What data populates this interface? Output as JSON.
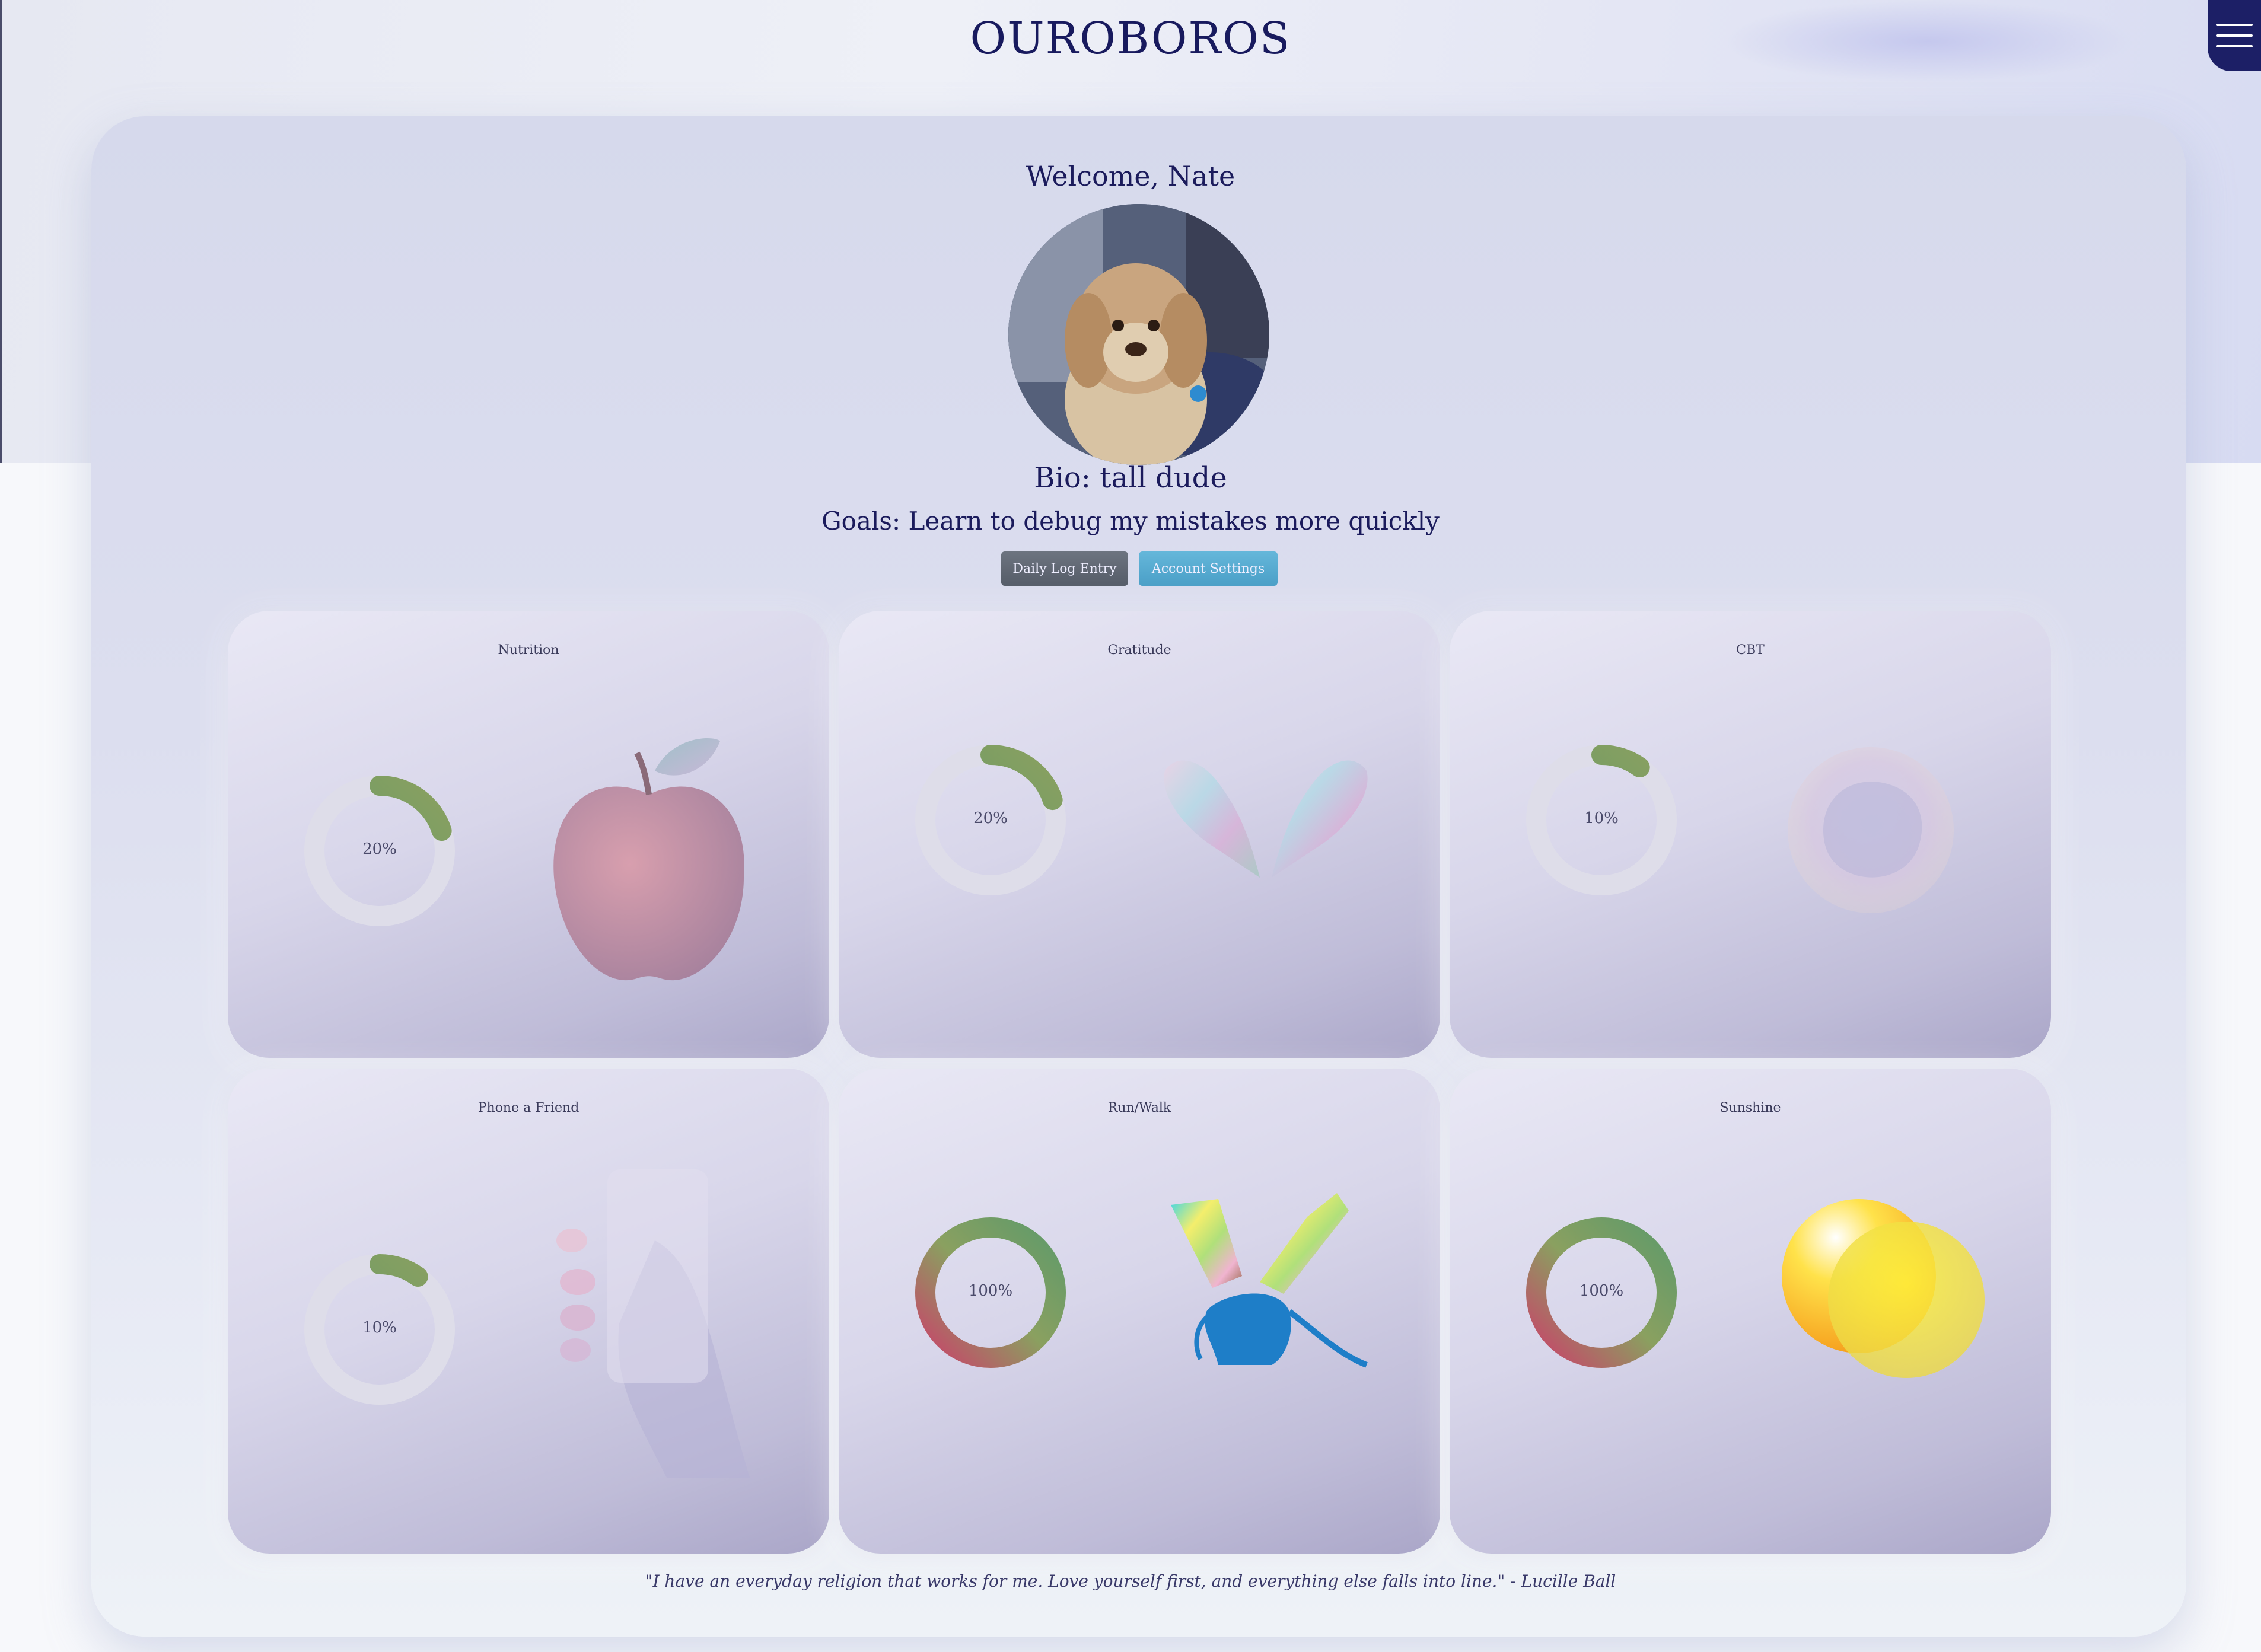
{
  "app": {
    "logo": "OUROBOROS"
  },
  "header": {
    "menu_icon": "hamburger-icon"
  },
  "profile": {
    "welcome": "Welcome, Nate",
    "bio": "Bio: tall dude",
    "goals": "Goals: Learn to debug my mistakes more quickly"
  },
  "actions": {
    "daily_log_label": "Daily Log Entry",
    "account_settings_label": "Account Settings"
  },
  "habits": [
    {
      "title": "Nutrition",
      "percent": 20,
      "percent_label": "20%",
      "icon": "apple-icon"
    },
    {
      "title": "Gratitude",
      "percent": 20,
      "percent_label": "20%",
      "icon": "heart-hands-icon"
    },
    {
      "title": "CBT",
      "percent": 10,
      "percent_label": "10%",
      "icon": "brain-icon"
    },
    {
      "title": "Phone a Friend",
      "percent": 10,
      "percent_label": "10%",
      "icon": "phone-icon"
    },
    {
      "title": "Run/Walk",
      "percent": 100,
      "percent_label": "100%",
      "icon": "runner-icon"
    },
    {
      "title": "Sunshine",
      "percent": 100,
      "percent_label": "100%",
      "icon": "sun-icon"
    }
  ],
  "quote": "\"I have an everyday religion that works for me. Love yourself first, and everything else falls into line.\" - Lucille Ball",
  "colors": {
    "brand": "#1c1f66",
    "progress_green": "#5f9a6a",
    "progress_red": "#c9426a",
    "button_gray": "#5e6571",
    "button_blue": "#55aad0"
  }
}
